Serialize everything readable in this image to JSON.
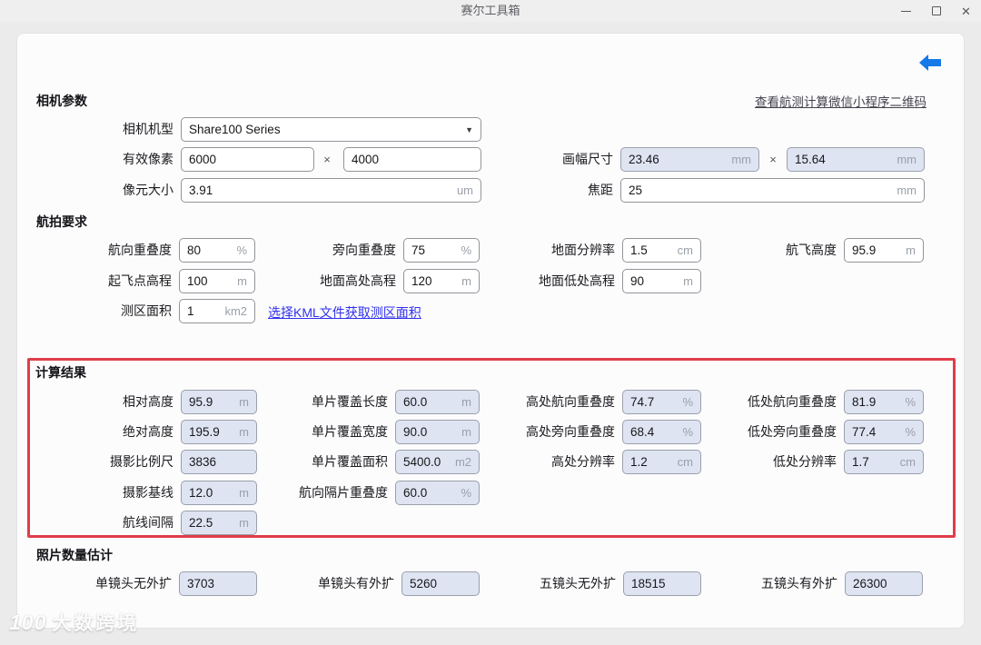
{
  "window": {
    "title": "赛尔工具箱"
  },
  "icons": {
    "close": "✕",
    "dropdown": "▼"
  },
  "toolbar": {
    "qr_link": "查看航测计算微信小程序二维码"
  },
  "camera": {
    "section_title": "相机参数",
    "model": {
      "label": "相机机型",
      "value": "Share100 Series"
    },
    "pixels": {
      "label": "有效像素",
      "width": "6000",
      "height": "4000",
      "times": "×"
    },
    "pixel_size": {
      "label": "像元大小",
      "value": "3.91",
      "unit": "um"
    },
    "frame": {
      "label": "画幅尺寸",
      "width": "23.46",
      "width_unit": "mm",
      "height": "15.64",
      "height_unit": "mm",
      "times": "×"
    },
    "focal": {
      "label": "焦距",
      "value": "25",
      "unit": "mm"
    }
  },
  "aerial": {
    "section_title": "航拍要求",
    "kml_link": "选择KML文件获取测区面积",
    "fields": [
      {
        "label": "航向重叠度",
        "value": "80",
        "unit": "%"
      },
      {
        "label": "旁向重叠度",
        "value": "75",
        "unit": "%"
      },
      {
        "label": "地面分辨率",
        "value": "1.5",
        "unit": "cm"
      },
      {
        "label": "航飞高度",
        "value": "95.9",
        "unit": "m"
      },
      {
        "label": "起飞点高程",
        "value": "100",
        "unit": "m"
      },
      {
        "label": "地面高处高程",
        "value": "120",
        "unit": "m"
      },
      {
        "label": "地面低处高程",
        "value": "90",
        "unit": "m"
      },
      {
        "label": "测区面积",
        "value": "1",
        "unit": "km2"
      }
    ]
  },
  "results": {
    "section_title": "计算结果",
    "fields": [
      {
        "label": "相对高度",
        "value": "95.9",
        "unit": "m"
      },
      {
        "label": "单片覆盖长度",
        "value": "60.0",
        "unit": "m"
      },
      {
        "label": "高处航向重叠度",
        "value": "74.7",
        "unit": "%"
      },
      {
        "label": "低处航向重叠度",
        "value": "81.9",
        "unit": "%"
      },
      {
        "label": "绝对高度",
        "value": "195.9",
        "unit": "m"
      },
      {
        "label": "单片覆盖宽度",
        "value": "90.0",
        "unit": "m"
      },
      {
        "label": "高处旁向重叠度",
        "value": "68.4",
        "unit": "%"
      },
      {
        "label": "低处旁向重叠度",
        "value": "77.4",
        "unit": "%"
      },
      {
        "label": "摄影比例尺",
        "value": "3836",
        "unit": ""
      },
      {
        "label": "单片覆盖面积",
        "value": "5400.0",
        "unit": "m2"
      },
      {
        "label": "高处分辨率",
        "value": "1.2",
        "unit": "cm"
      },
      {
        "label": "低处分辨率",
        "value": "1.7",
        "unit": "cm"
      },
      {
        "label": "摄影基线",
        "value": "12.0",
        "unit": "m"
      },
      {
        "label": "航向隔片重叠度",
        "value": "60.0",
        "unit": "%"
      },
      {
        "label": "航线间隔",
        "value": "22.5",
        "unit": "m"
      }
    ]
  },
  "photos": {
    "section_title": "照片数量估计",
    "fields": [
      {
        "label": "单镜头无外扩",
        "value": "3703"
      },
      {
        "label": "单镜头有外扩",
        "value": "5260"
      },
      {
        "label": "五镜头无外扩",
        "value": "18515"
      },
      {
        "label": "五镜头有外扩",
        "value": "26300"
      }
    ]
  },
  "watermark": {
    "logo": "100",
    "text": "大数跨境"
  },
  "colors": {
    "accent_blue": "#1679e8",
    "link_blue": "#3030ee",
    "highlight_red": "#e03d4a",
    "readonly_bg": "#dee4f2"
  }
}
